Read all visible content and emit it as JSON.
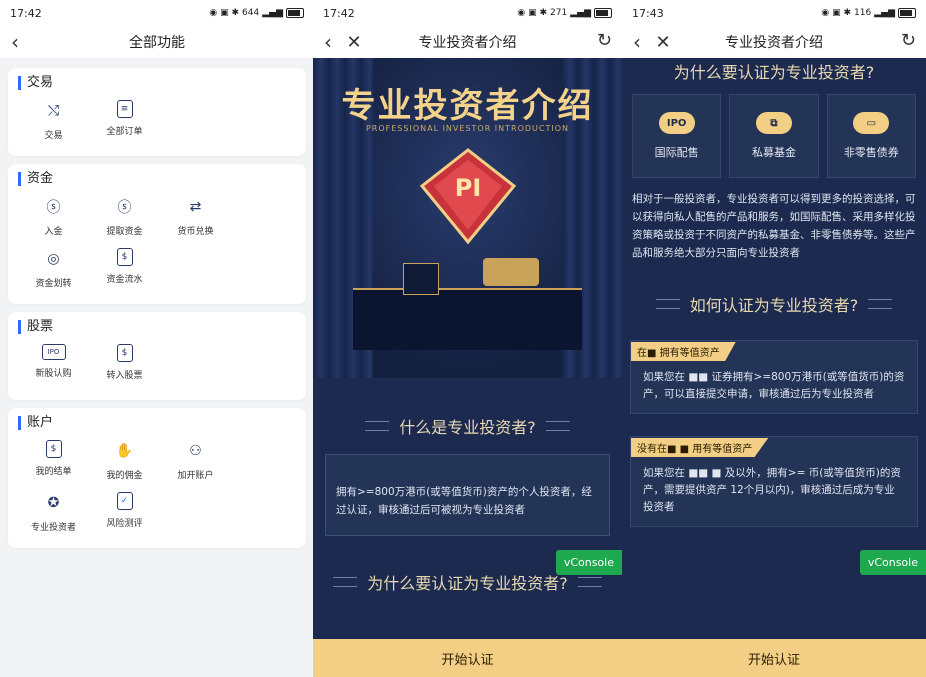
{
  "panel1": {
    "status": {
      "time": "17:42",
      "net": "644\nB/s"
    },
    "title": "全部功能",
    "sections": [
      {
        "title": "交易",
        "items": [
          "交易",
          "全部订单"
        ],
        "icons": [
          "shuffle-icon",
          "order-list-icon"
        ]
      },
      {
        "title": "资金",
        "items": [
          "入金",
          "提取资金",
          "货币兑换",
          "资金划转",
          "资金流水"
        ],
        "icons": [
          "deposit-icon",
          "withdraw-icon",
          "currency-exchange-icon",
          "transfer-icon",
          "fund-flow-icon"
        ]
      },
      {
        "title": "股票",
        "items": [
          "新股认购",
          "转入股票"
        ],
        "icons": [
          "ipo-icon",
          "stock-transfer-in-icon"
        ]
      },
      {
        "title": "账户",
        "items": [
          "我的结单",
          "我的佣金",
          "加开账户",
          "专业投资者",
          "风险测评"
        ],
        "icons": [
          "statement-icon",
          "commission-icon",
          "add-account-icon",
          "pro-investor-icon",
          "risk-assessment-icon"
        ]
      }
    ]
  },
  "panel2": {
    "status": {
      "time": "17:42",
      "net": "271\nB/s"
    },
    "title": "专业投资者介绍",
    "hero_title": "专业投资者介绍",
    "hero_sub": "PROFESSIONAL INVESTOR INTRODUCTION",
    "badge": "PI",
    "section1_title": "什么是专业投资者?",
    "section1_text": "拥有>=800万港币(或等值货币)资产的个人投资者，经过认证，审核通过后可被视为专业投资者",
    "section2_title": "为什么要认证为专业投资者?",
    "cta": "开始认证",
    "vconsole": "vConsole"
  },
  "panel3": {
    "status": {
      "time": "17:43",
      "net": "116\nB/s"
    },
    "title": "专业投资者介绍",
    "top_title": "为什么要认证为专业投资者?",
    "benefits": [
      {
        "icon": "IPO",
        "label": "国际配售"
      },
      {
        "icon": "⧉",
        "label": "私募基金"
      },
      {
        "icon": "▭",
        "label": "非零售债券"
      }
    ],
    "para": "相对于一般投资者，专业投资者可以得到更多的投资选择，可以获得向私人配售的产品和服务，如国际配售、采用多样化投资策略或投资于不同资产的私募基金、非零售债券等。这些产品和服务绝大部分只面向专业投资者",
    "section_title": "如何认证为专业投资者?",
    "card1_tag": "在■ 拥有等值资产",
    "card1_text": "如果您在 ■■ 证券拥有>=800万港币(或等值货币)的资产，可以直接提交申请，审核通过后为专业投资者",
    "card2_tag": "没有在■ ■ 用有等值资产",
    "card2_text": "如果您在 ■■ ■ 及以外，拥有>= 币(或等值货币)的资产，需要提供资产 12个月以内)，审核通过后成为专业投资者",
    "cta": "开始认证",
    "vconsole": "vConsole"
  }
}
